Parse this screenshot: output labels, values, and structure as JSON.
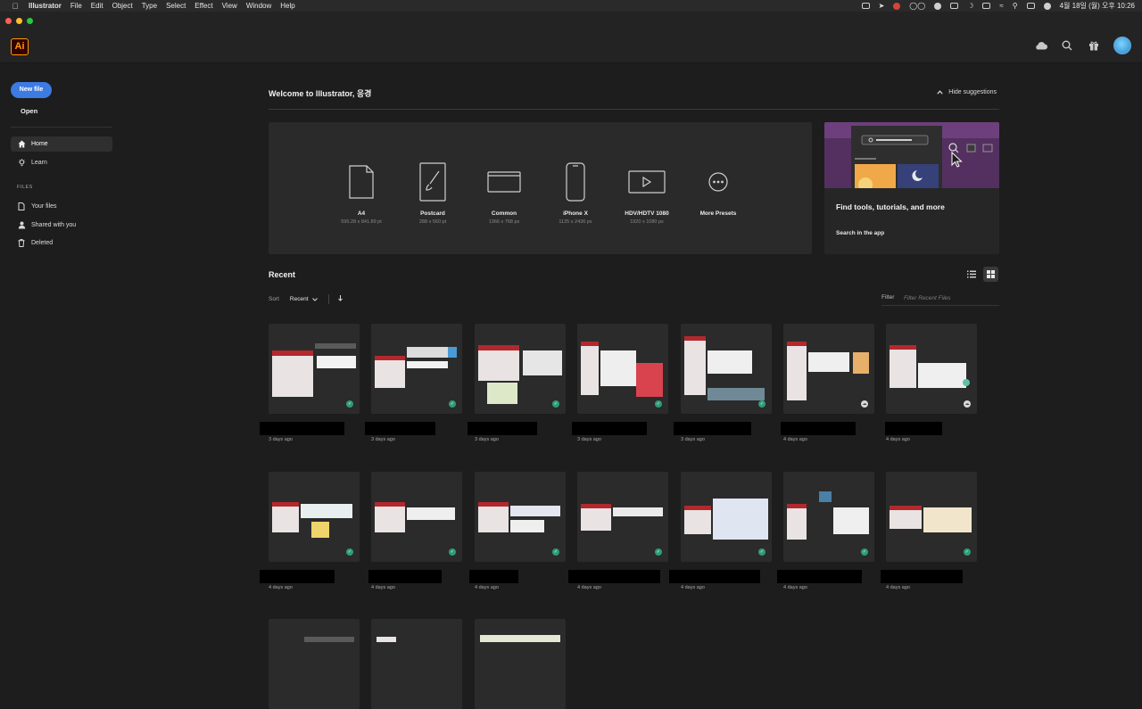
{
  "menubar": {
    "app": "Illustrator",
    "items": [
      "File",
      "Edit",
      "Object",
      "Type",
      "Select",
      "Effect",
      "View",
      "Window",
      "Help"
    ],
    "datetime": "4월 18일 (월) 오후 10:26"
  },
  "app": {
    "logo_text": "Ai",
    "accent": "#ff9a00"
  },
  "sidebar": {
    "new_file_label": "New file",
    "open_label": "Open",
    "nav": [
      {
        "label": "Home",
        "icon": "home-icon",
        "active": true
      },
      {
        "label": "Learn",
        "icon": "lightbulb-icon",
        "active": false
      }
    ],
    "files_section_label": "FILES",
    "files": [
      {
        "label": "Your files",
        "icon": "file-icon"
      },
      {
        "label": "Shared with you",
        "icon": "people-icon"
      },
      {
        "label": "Deleted",
        "icon": "trash-icon"
      }
    ]
  },
  "main": {
    "welcome": "Welcome to Illustrator, 응경",
    "hide_suggestions": "Hide suggestions",
    "presets": [
      {
        "name": "A4",
        "size": "595.28 x 841.89 pt"
      },
      {
        "name": "Postcard",
        "size": "288 x 560 pt"
      },
      {
        "name": "Common",
        "size": "1366 x 768 px"
      },
      {
        "name": "iPhone X",
        "size": "1125 x 2436 px"
      },
      {
        "name": "HDV/HDTV 1080",
        "size": "1920 x 1080 px"
      },
      {
        "name": "More Presets",
        "size": ""
      }
    ],
    "promo": {
      "title": "Find tools, tutorials, and more",
      "link": "Search in the app"
    },
    "recent": {
      "heading": "Recent",
      "sort_label": "Sort",
      "sort_value": "Recent",
      "filter_label": "Filter",
      "filter_placeholder": "Filter Recent Files"
    },
    "files_row1": [
      {
        "date": "3 days ago",
        "status": "synced"
      },
      {
        "date": "3 days ago",
        "status": "synced"
      },
      {
        "date": "3 days ago",
        "status": "synced"
      },
      {
        "date": "3 days ago",
        "status": "synced"
      },
      {
        "date": "3 days ago",
        "status": "synced"
      },
      {
        "date": "4 days ago",
        "status": "cloud"
      },
      {
        "date": "4 days ago",
        "status": "cloud"
      }
    ],
    "files_row2": [
      {
        "date": "4 days ago",
        "status": "synced"
      },
      {
        "date": "4 days ago",
        "status": "synced"
      },
      {
        "date": "4 days ago",
        "status": "synced"
      },
      {
        "date": "4 days ago",
        "status": "synced"
      },
      {
        "date": "4 days ago",
        "status": "synced"
      },
      {
        "date": "4 days ago",
        "status": "synced"
      },
      {
        "date": "4 days ago",
        "status": "synced"
      }
    ]
  },
  "colors": {
    "primary_button": "#3d7be3",
    "synced_badge": "#2d9d78",
    "promo_bg": "#53305f"
  }
}
